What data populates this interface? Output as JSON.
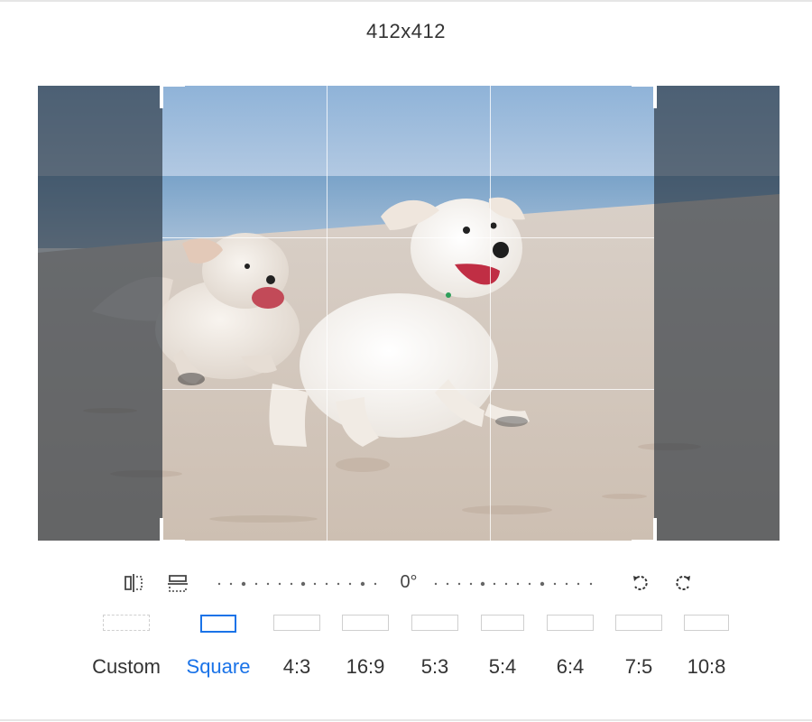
{
  "header": {
    "dimensions": "412x412"
  },
  "image": {
    "description_icon": "photo-of-two-puppies-on-beach"
  },
  "toolbar": {
    "flip_horizontal_icon": "flip-horizontal-icon",
    "flip_vertical_icon": "flip-vertical-icon",
    "rotation_angle": "0°",
    "rotate_left_icon": "rotate-left-icon",
    "rotate_right_icon": "rotate-right-icon"
  },
  "ratios": [
    {
      "label": "Custom",
      "active": false
    },
    {
      "label": "Square",
      "active": true
    },
    {
      "label": "4:3",
      "active": false
    },
    {
      "label": "16:9",
      "active": false
    },
    {
      "label": "5:3",
      "active": false
    },
    {
      "label": "5:4",
      "active": false
    },
    {
      "label": "6:4",
      "active": false
    },
    {
      "label": "7:5",
      "active": false
    },
    {
      "label": "10:8",
      "active": false
    }
  ],
  "colors": {
    "accent": "#1a73e8",
    "shade": "#232d37",
    "border": "#cfcfcf"
  }
}
